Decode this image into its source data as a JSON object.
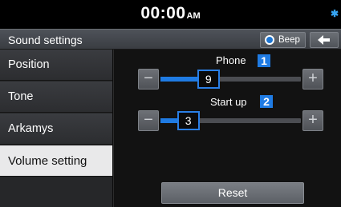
{
  "status_bar": {
    "time": "00:00",
    "ampm": "AM",
    "icons": [
      "bluetooth-icon"
    ]
  },
  "header": {
    "title": "Sound settings",
    "beep_label": "Beep",
    "beep_selected": true,
    "back_icon": "back-arrow-icon"
  },
  "sidebar": {
    "items": [
      {
        "label": "Position",
        "active": false
      },
      {
        "label": "Tone",
        "active": false
      },
      {
        "label": "Arkamys",
        "active": false
      },
      {
        "label": "Volume setting",
        "active": true
      }
    ]
  },
  "volume": {
    "rows": [
      {
        "label": "Phone",
        "badge": "1",
        "value": "9",
        "level": 9,
        "max": 35
      },
      {
        "label": "Start up",
        "badge": "2",
        "value": "3",
        "level": 3,
        "max": 35
      }
    ],
    "minus_glyph": "−",
    "plus_glyph": "+",
    "reset_label": "Reset"
  },
  "colors": {
    "accent": "#1f7be3",
    "active_item_bg": "#e9e9ea",
    "bluetooth": "#36a3f0"
  }
}
